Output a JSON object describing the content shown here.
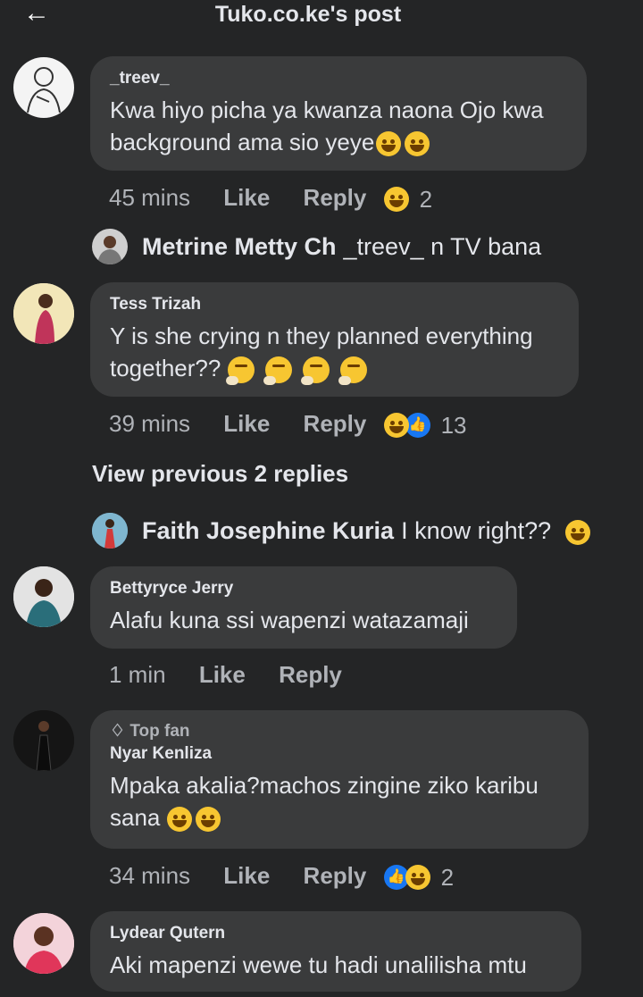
{
  "header": {
    "back_icon": "arrow-left-icon",
    "title": "Tuko.co.ke's post"
  },
  "comments": [
    {
      "name": "_treev_",
      "text": "Kwa hiyo picha ya kwanza naona Ojo kwa background  ama sio yeye",
      "time": "45 mins",
      "like": "Like",
      "reply": "Reply",
      "reaction_count": "2",
      "reactions": [
        "laughing-emoji"
      ]
    },
    {
      "name": "Tess Trizah",
      "text": "Y is she crying n they planned everything together??",
      "time": "39 mins",
      "like": "Like",
      "reply": "Reply",
      "reaction_count": "13",
      "reactions": [
        "laughing-emoji",
        "like-icon"
      ]
    },
    {
      "name": "Bettyryce Jerry",
      "text": "Alafu kuna ssi wapenzi watazamaji",
      "time": "1 min",
      "like": "Like",
      "reply": "Reply"
    },
    {
      "badge": "Top fan",
      "name": "Nyar Kenliza",
      "text": "Mpaka akalia?machos zingine ziko karibu sana",
      "time": "34 mins",
      "like": "Like",
      "reply": "Reply",
      "reaction_count": "2",
      "reactions": [
        "like-icon",
        "laughing-emoji"
      ]
    },
    {
      "name": "Lydear Qutern",
      "text": "Aki mapenzi wewe tu hadi unalilisha mtu"
    }
  ],
  "replies": [
    {
      "name": "Metrine Metty Ch",
      "text": "_treev_ n TV bana"
    },
    {
      "name": "Faith Josephine Kuria",
      "text": "I know right??"
    }
  ],
  "view_previous": "View previous 2 replies",
  "colors": {
    "background": "#242526",
    "bubble": "#3a3b3c",
    "text": "#e4e6eb",
    "muted": "#b0b3b8",
    "like_blue": "#1877f2",
    "emoji_yellow": "#f7c631"
  }
}
